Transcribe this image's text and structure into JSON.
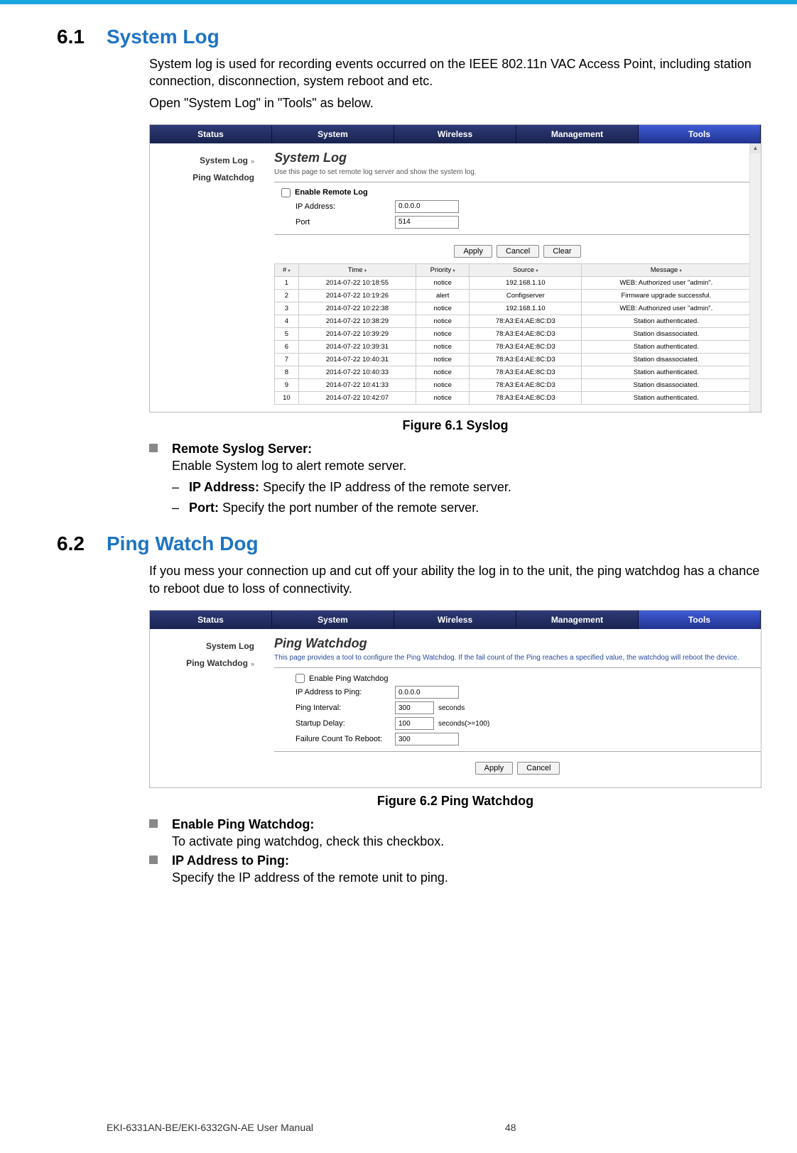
{
  "section1": {
    "num": "6.1",
    "title": "System Log",
    "p1": "System log is used for recording events occurred on the IEEE 802.11n VAC Access Point, including station connection, disconnection, system reboot and etc.",
    "p2": "Open \"System Log\" in \"Tools\" as below."
  },
  "fig1": {
    "tabs": [
      "Status",
      "System",
      "Wireless",
      "Management",
      "Tools"
    ],
    "sidebar": [
      {
        "label": "System Log",
        "active": true
      },
      {
        "label": "Ping Watchdog",
        "active": false
      }
    ],
    "panelTitle": "System Log",
    "panelDesc": "Use this page to set remote log server and show the system log.",
    "enableLabel": "Enable Remote Log",
    "ipLabel": "IP Address:",
    "ipValue": "0.0.0.0",
    "portLabel": "Port",
    "portValue": "514",
    "buttons": [
      "Apply",
      "Cancel",
      "Clear"
    ],
    "cols": [
      "#",
      "Time",
      "Priority",
      "Source",
      "Message"
    ],
    "rows": [
      [
        "1",
        "2014-07-22 10:18:55",
        "notice",
        "192.168.1.10",
        "WEB: Authorized user \"admin\"."
      ],
      [
        "2",
        "2014-07-22 10:19:26",
        "alert",
        "Configserver",
        "Firmware upgrade successful."
      ],
      [
        "3",
        "2014-07-22 10:22:38",
        "notice",
        "192.168.1.10",
        "WEB: Authorized user \"admin\"."
      ],
      [
        "4",
        "2014-07-22 10:38:29",
        "notice",
        "78:A3:E4:AE:8C:D3",
        "Station authenticated."
      ],
      [
        "5",
        "2014-07-22 10:39:29",
        "notice",
        "78:A3:E4:AE:8C:D3",
        "Station disassociated."
      ],
      [
        "6",
        "2014-07-22 10:39:31",
        "notice",
        "78:A3:E4:AE:8C:D3",
        "Station authenticated."
      ],
      [
        "7",
        "2014-07-22 10:40:31",
        "notice",
        "78:A3:E4:AE:8C:D3",
        "Station disassociated."
      ],
      [
        "8",
        "2014-07-22 10:40:33",
        "notice",
        "78:A3:E4:AE:8C:D3",
        "Station authenticated."
      ],
      [
        "9",
        "2014-07-22 10:41:33",
        "notice",
        "78:A3:E4:AE:8C:D3",
        "Station disassociated."
      ],
      [
        "10",
        "2014-07-22 10:42:07",
        "notice",
        "78:A3:E4:AE:8C:D3",
        "Station authenticated."
      ]
    ],
    "caption": "Figure 6.1 Syslog"
  },
  "bullets1": {
    "b1title": "Remote Syslog Server:",
    "b1text": "Enable System log to alert remote server.",
    "s1label": "IP Address:",
    "s1text": " Specify the IP address of the remote server.",
    "s2label": "Port:",
    "s2text": " Specify the port number of the remote server."
  },
  "section2": {
    "num": "6.2",
    "title": "Ping Watch Dog",
    "p1": "If you mess your connection up and cut off your ability the log in to the unit, the ping watchdog has a chance to reboot due to loss of connectivity."
  },
  "fig2": {
    "tabs": [
      "Status",
      "System",
      "Wireless",
      "Management",
      "Tools"
    ],
    "sidebar": [
      {
        "label": "System Log",
        "active": false
      },
      {
        "label": "Ping Watchdog",
        "active": true
      }
    ],
    "panelTitle": "Ping Watchdog",
    "panelDesc": "This page provides a tool to configure the Ping Watchdog. If the fail count of the Ping reaches a specified value, the watchdog will reboot the device.",
    "enableLabel": "Enable Ping Watchdog",
    "rows": [
      {
        "label": "IP Address to Ping:",
        "value": "0.0.0.0",
        "suffix": ""
      },
      {
        "label": "Ping Interval:",
        "value": "300",
        "suffix": "seconds"
      },
      {
        "label": "Startup Delay:",
        "value": "100",
        "suffix": "seconds(>=100)"
      },
      {
        "label": "Failure Count To Reboot:",
        "value": "300",
        "suffix": ""
      }
    ],
    "buttons": [
      "Apply",
      "Cancel"
    ],
    "caption": "Figure 6.2 Ping Watchdog"
  },
  "bullets2": {
    "b1title": "Enable Ping Watchdog:",
    "b1text": "To activate ping watchdog, check this checkbox.",
    "b2title": "IP Address to Ping:",
    "b2text": "Specify the IP address of the remote unit to ping."
  },
  "footer": {
    "manual": "EKI-6331AN-BE/EKI-6332GN-AE User Manual",
    "page": "48"
  }
}
